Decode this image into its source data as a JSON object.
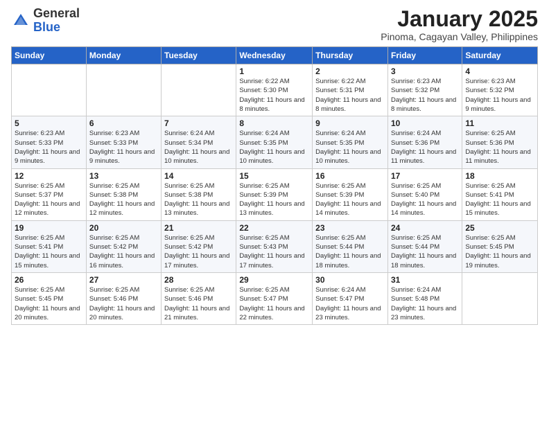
{
  "header": {
    "logo_general": "General",
    "logo_blue": "Blue",
    "month": "January 2025",
    "location": "Pinoma, Cagayan Valley, Philippines"
  },
  "days_of_week": [
    "Sunday",
    "Monday",
    "Tuesday",
    "Wednesday",
    "Thursday",
    "Friday",
    "Saturday"
  ],
  "weeks": [
    [
      {
        "day": "",
        "info": ""
      },
      {
        "day": "",
        "info": ""
      },
      {
        "day": "",
        "info": ""
      },
      {
        "day": "1",
        "info": "Sunrise: 6:22 AM\nSunset: 5:30 PM\nDaylight: 11 hours and 8 minutes."
      },
      {
        "day": "2",
        "info": "Sunrise: 6:22 AM\nSunset: 5:31 PM\nDaylight: 11 hours and 8 minutes."
      },
      {
        "day": "3",
        "info": "Sunrise: 6:23 AM\nSunset: 5:32 PM\nDaylight: 11 hours and 8 minutes."
      },
      {
        "day": "4",
        "info": "Sunrise: 6:23 AM\nSunset: 5:32 PM\nDaylight: 11 hours and 9 minutes."
      }
    ],
    [
      {
        "day": "5",
        "info": "Sunrise: 6:23 AM\nSunset: 5:33 PM\nDaylight: 11 hours and 9 minutes."
      },
      {
        "day": "6",
        "info": "Sunrise: 6:23 AM\nSunset: 5:33 PM\nDaylight: 11 hours and 9 minutes."
      },
      {
        "day": "7",
        "info": "Sunrise: 6:24 AM\nSunset: 5:34 PM\nDaylight: 11 hours and 10 minutes."
      },
      {
        "day": "8",
        "info": "Sunrise: 6:24 AM\nSunset: 5:35 PM\nDaylight: 11 hours and 10 minutes."
      },
      {
        "day": "9",
        "info": "Sunrise: 6:24 AM\nSunset: 5:35 PM\nDaylight: 11 hours and 10 minutes."
      },
      {
        "day": "10",
        "info": "Sunrise: 6:24 AM\nSunset: 5:36 PM\nDaylight: 11 hours and 11 minutes."
      },
      {
        "day": "11",
        "info": "Sunrise: 6:25 AM\nSunset: 5:36 PM\nDaylight: 11 hours and 11 minutes."
      }
    ],
    [
      {
        "day": "12",
        "info": "Sunrise: 6:25 AM\nSunset: 5:37 PM\nDaylight: 11 hours and 12 minutes."
      },
      {
        "day": "13",
        "info": "Sunrise: 6:25 AM\nSunset: 5:38 PM\nDaylight: 11 hours and 12 minutes."
      },
      {
        "day": "14",
        "info": "Sunrise: 6:25 AM\nSunset: 5:38 PM\nDaylight: 11 hours and 13 minutes."
      },
      {
        "day": "15",
        "info": "Sunrise: 6:25 AM\nSunset: 5:39 PM\nDaylight: 11 hours and 13 minutes."
      },
      {
        "day": "16",
        "info": "Sunrise: 6:25 AM\nSunset: 5:39 PM\nDaylight: 11 hours and 14 minutes."
      },
      {
        "day": "17",
        "info": "Sunrise: 6:25 AM\nSunset: 5:40 PM\nDaylight: 11 hours and 14 minutes."
      },
      {
        "day": "18",
        "info": "Sunrise: 6:25 AM\nSunset: 5:41 PM\nDaylight: 11 hours and 15 minutes."
      }
    ],
    [
      {
        "day": "19",
        "info": "Sunrise: 6:25 AM\nSunset: 5:41 PM\nDaylight: 11 hours and 15 minutes."
      },
      {
        "day": "20",
        "info": "Sunrise: 6:25 AM\nSunset: 5:42 PM\nDaylight: 11 hours and 16 minutes."
      },
      {
        "day": "21",
        "info": "Sunrise: 6:25 AM\nSunset: 5:42 PM\nDaylight: 11 hours and 17 minutes."
      },
      {
        "day": "22",
        "info": "Sunrise: 6:25 AM\nSunset: 5:43 PM\nDaylight: 11 hours and 17 minutes."
      },
      {
        "day": "23",
        "info": "Sunrise: 6:25 AM\nSunset: 5:44 PM\nDaylight: 11 hours and 18 minutes."
      },
      {
        "day": "24",
        "info": "Sunrise: 6:25 AM\nSunset: 5:44 PM\nDaylight: 11 hours and 18 minutes."
      },
      {
        "day": "25",
        "info": "Sunrise: 6:25 AM\nSunset: 5:45 PM\nDaylight: 11 hours and 19 minutes."
      }
    ],
    [
      {
        "day": "26",
        "info": "Sunrise: 6:25 AM\nSunset: 5:45 PM\nDaylight: 11 hours and 20 minutes."
      },
      {
        "day": "27",
        "info": "Sunrise: 6:25 AM\nSunset: 5:46 PM\nDaylight: 11 hours and 20 minutes."
      },
      {
        "day": "28",
        "info": "Sunrise: 6:25 AM\nSunset: 5:46 PM\nDaylight: 11 hours and 21 minutes."
      },
      {
        "day": "29",
        "info": "Sunrise: 6:25 AM\nSunset: 5:47 PM\nDaylight: 11 hours and 22 minutes."
      },
      {
        "day": "30",
        "info": "Sunrise: 6:24 AM\nSunset: 5:47 PM\nDaylight: 11 hours and 23 minutes."
      },
      {
        "day": "31",
        "info": "Sunrise: 6:24 AM\nSunset: 5:48 PM\nDaylight: 11 hours and 23 minutes."
      },
      {
        "day": "",
        "info": ""
      }
    ]
  ]
}
